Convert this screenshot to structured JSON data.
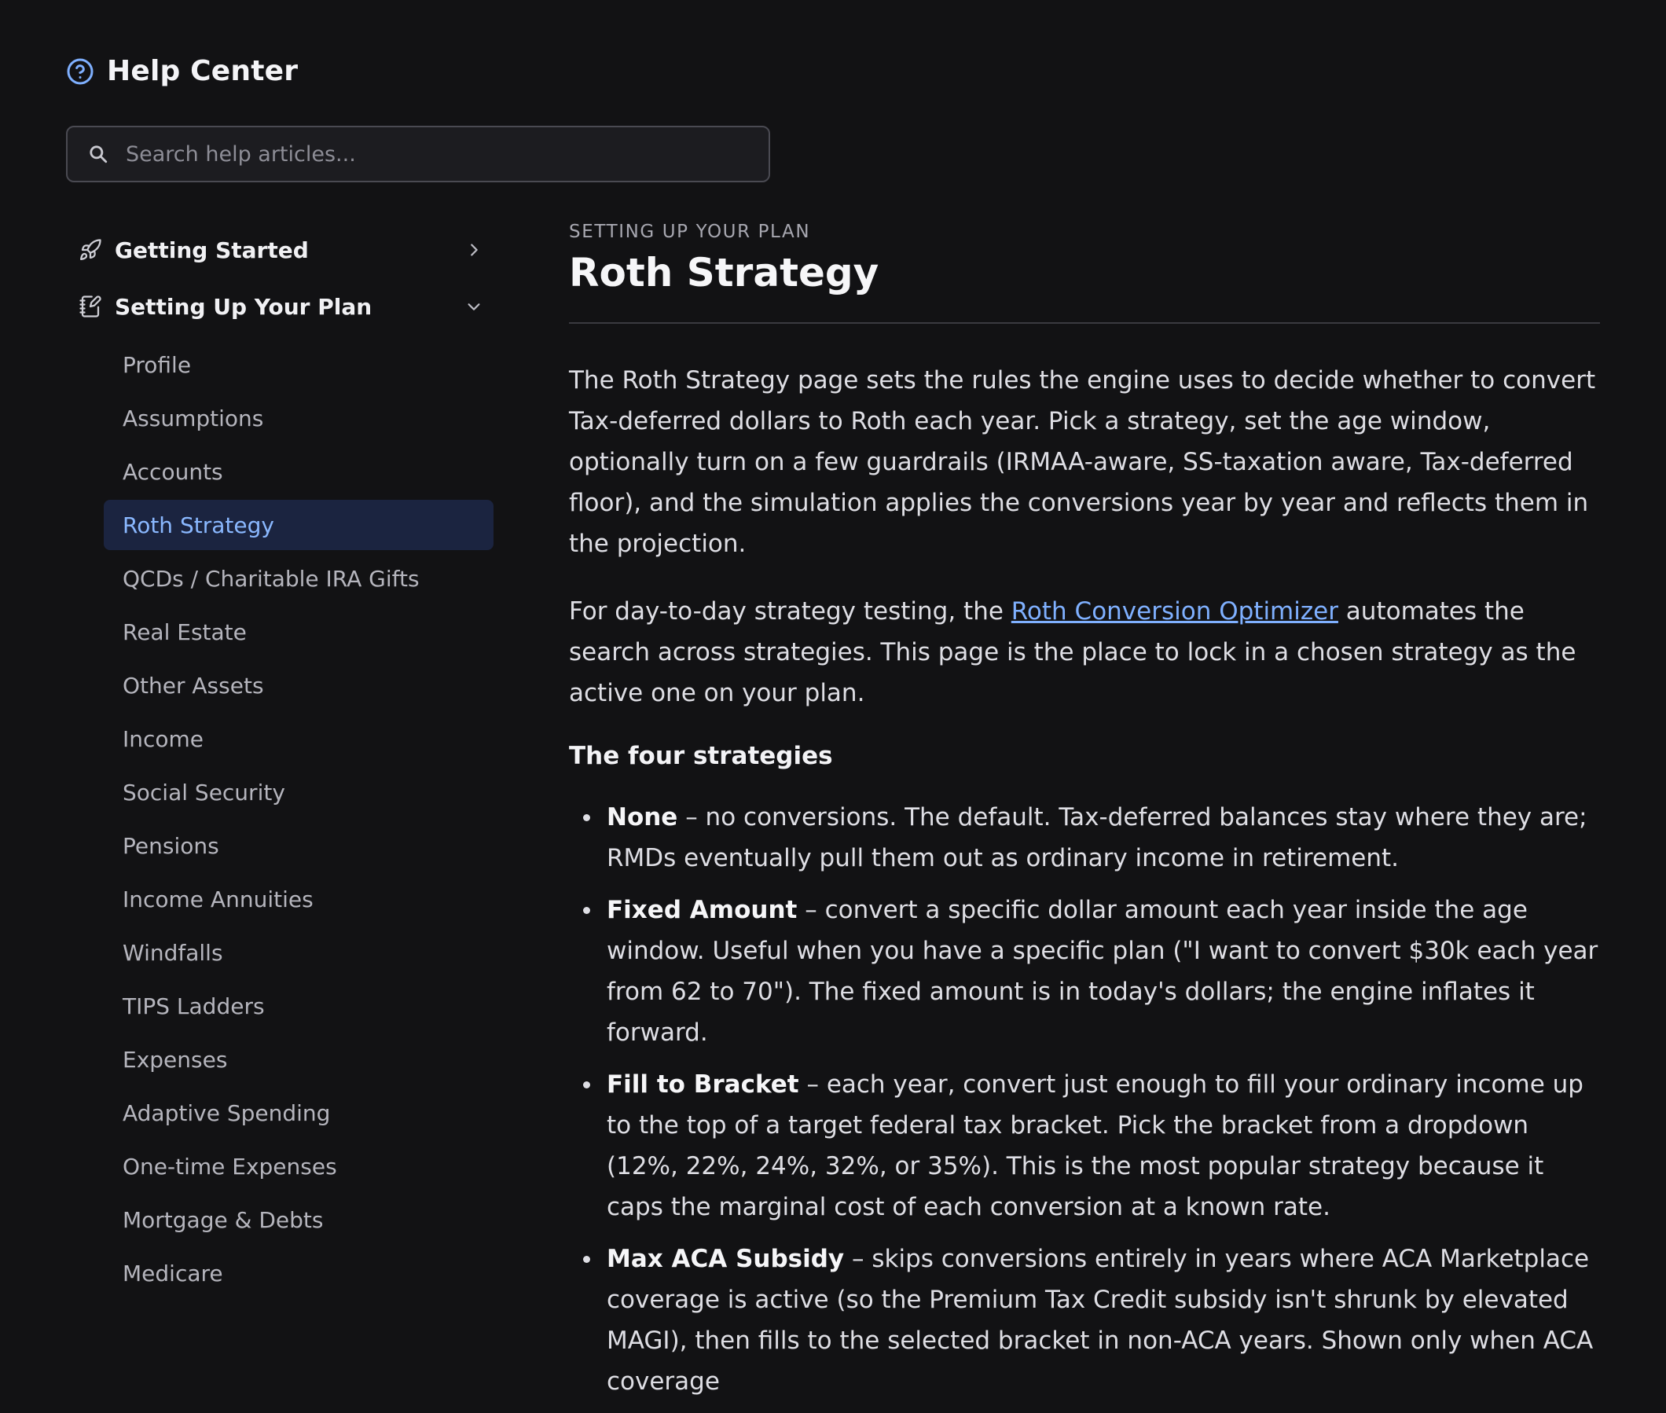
{
  "app": {
    "title": "Help Center"
  },
  "search": {
    "placeholder": "Search help articles..."
  },
  "sidebar": {
    "sections": [
      {
        "label": "Getting Started",
        "expanded": false
      },
      {
        "label": "Setting Up Your Plan",
        "expanded": true
      }
    ],
    "items": [
      "Profile",
      "Assumptions",
      "Accounts",
      "Roth Strategy",
      "QCDs / Charitable IRA Gifts",
      "Real Estate",
      "Other Assets",
      "Income",
      "Social Security",
      "Pensions",
      "Income Annuities",
      "Windfalls",
      "TIPS Ladders",
      "Expenses",
      "Adaptive Spending",
      "One-time Expenses",
      "Mortgage & Debts",
      "Medicare"
    ],
    "active_item": "Roth Strategy"
  },
  "article": {
    "eyebrow": "SETTING UP YOUR PLAN",
    "title": "Roth Strategy",
    "intro": "The Roth Strategy page sets the rules the engine uses to decide whether to convert Tax-deferred dollars to Roth each year. Pick a strategy, set the age window, optionally turn on a few guardrails (IRMAA-aware, SS-taxation aware, Tax-deferred floor), and the simulation applies the conversions year by year and reflects them in the projection.",
    "p2_before": "For day-to-day strategy testing, the ",
    "p2_link": "Roth Conversion Optimizer",
    "p2_after": " automates the search across strategies. This page is the place to lock in a chosen strategy as the active one on your plan.",
    "strategies_heading": "The four strategies",
    "strategies": [
      {
        "name": "None",
        "desc": " – no conversions. The default. Tax-deferred balances stay where they are; RMDs eventually pull them out as ordinary income in retirement."
      },
      {
        "name": "Fixed Amount",
        "desc": " – convert a specific dollar amount each year inside the age window. Useful when you have a specific plan (\"I want to convert $30k each year from 62 to 70\"). The fixed amount is in today's dollars; the engine inflates it forward."
      },
      {
        "name": "Fill to Bracket",
        "desc": " – each year, convert just enough to fill your ordinary income up to the top of a target federal tax bracket. Pick the bracket from a dropdown (12%, 22%, 24%, 32%, or 35%). This is the most popular strategy because it caps the marginal cost of each conversion at a known rate."
      },
      {
        "name": "Max ACA Subsidy",
        "desc": " – skips conversions entirely in years where ACA Marketplace coverage is active (so the Premium Tax Credit subsidy isn't shrunk by elevated MAGI), then fills to the selected bracket in non-ACA years. Shown only when ACA coverage"
      }
    ]
  },
  "colors": {
    "background": "#121214",
    "accent": "#8ab8ff",
    "active_bg": "#1b2440",
    "link": "#7fb0ff"
  },
  "icons": {
    "header": "help-circle-icon",
    "search": "search-icon",
    "getting_started": "rocket-icon",
    "setting_up": "notebook-icon"
  }
}
